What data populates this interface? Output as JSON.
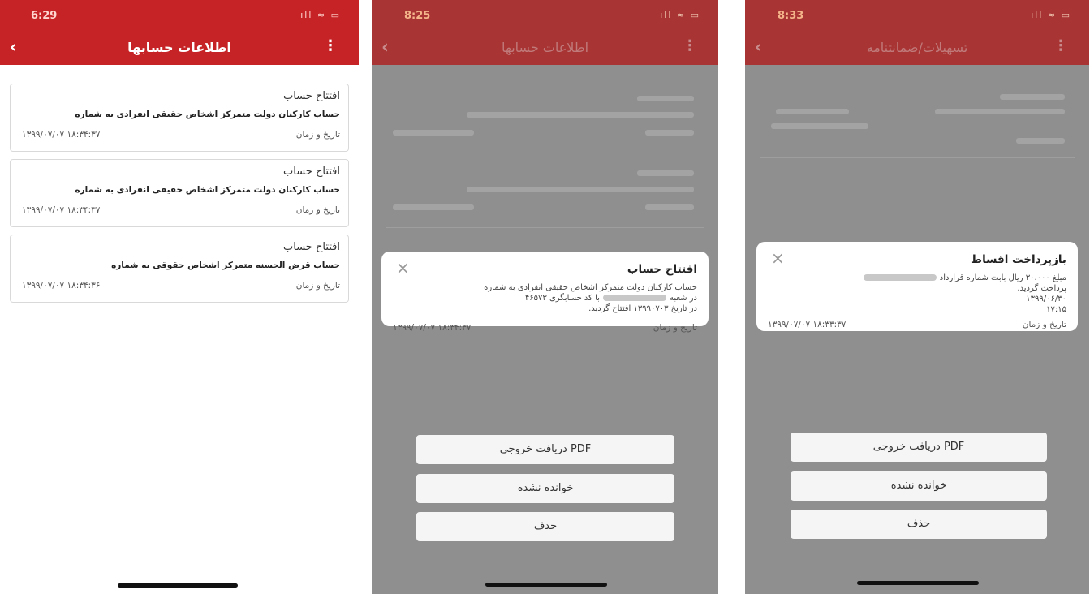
{
  "accent_color": "#c62326",
  "screen1": {
    "status_time": "6:29",
    "status_icons": "ıll ≈ ▭",
    "title": "اطلاعات حسابها",
    "back_icon": "‹",
    "menu_icon": "⋮",
    "cards": [
      {
        "title": "افتتاح حساب",
        "desc": "حساب کارکنان دولت متمرکز اشخاص حقیقی انفرادی به شماره",
        "date_label": "تاریخ و زمان",
        "date_value": "۱۳۹۹/۰۷/۰۷  ۱۸:۳۴:۳۷"
      },
      {
        "title": "افتتاح حساب",
        "desc": "حساب کارکنان دولت متمرکز اشخاص حقیقی انفرادی به شماره",
        "date_label": "تاریخ و زمان",
        "date_value": "۱۳۹۹/۰۷/۰۷  ۱۸:۳۴:۳۷"
      },
      {
        "title": "افتتاح حساب",
        "desc": "حساب قرض الحسنه متمرکز اشخاص حقوقی  به شماره",
        "date_label": "تاریخ و زمان",
        "date_value": "۱۳۹۹/۰۷/۰۷  ۱۸:۳۴:۳۶"
      }
    ]
  },
  "screen2": {
    "status_time": "8:25",
    "status_icons": "ıll ≈ ▭",
    "title": "اطلاعات حسابها",
    "modal": {
      "title": "افتتاح حساب",
      "close_icon": "×",
      "line1": "حساب کارکنان دولت متمرکز اشخاص حقیقی انفرادی به شماره",
      "line2a": "در شعبه",
      "line2b": "با کد حسابگری ۴۶۵۷۳",
      "line3": "در تاریخ ۱۳۹۹۰۷۰۳ افتتاح گردید.",
      "date_label": "تاریخ و زمان",
      "date_value": "۱۳۹۹/۰۷/۰۷ ۱۸:۳۴:۳۷"
    },
    "buttons": {
      "pdf": "دریافت خروجی PDF",
      "unread": "خوانده نشده",
      "delete": "حذف"
    }
  },
  "screen3": {
    "status_time": "8:33",
    "status_icons": "ıll ≈ ▭",
    "title": "تسهیلات/ضمانتنامه",
    "modal": {
      "title": "بازپرداخت اقساط",
      "close_icon": "×",
      "line1": "مبلغ ۳۰،۰۰۰ ریال بابت شماره قرارداد",
      "line2": "پرداخت گردید.",
      "line3": "۱۳۹۹/۰۶/۳۰",
      "line4": "۱۷:۱۵",
      "date_label": "تاریخ و زمان",
      "date_value": "۱۳۹۹/۰۷/۰۷ ۱۸:۳۳:۳۷"
    },
    "buttons": {
      "pdf": "دریافت خروجی PDF",
      "unread": "خوانده نشده",
      "delete": "حذف"
    }
  }
}
